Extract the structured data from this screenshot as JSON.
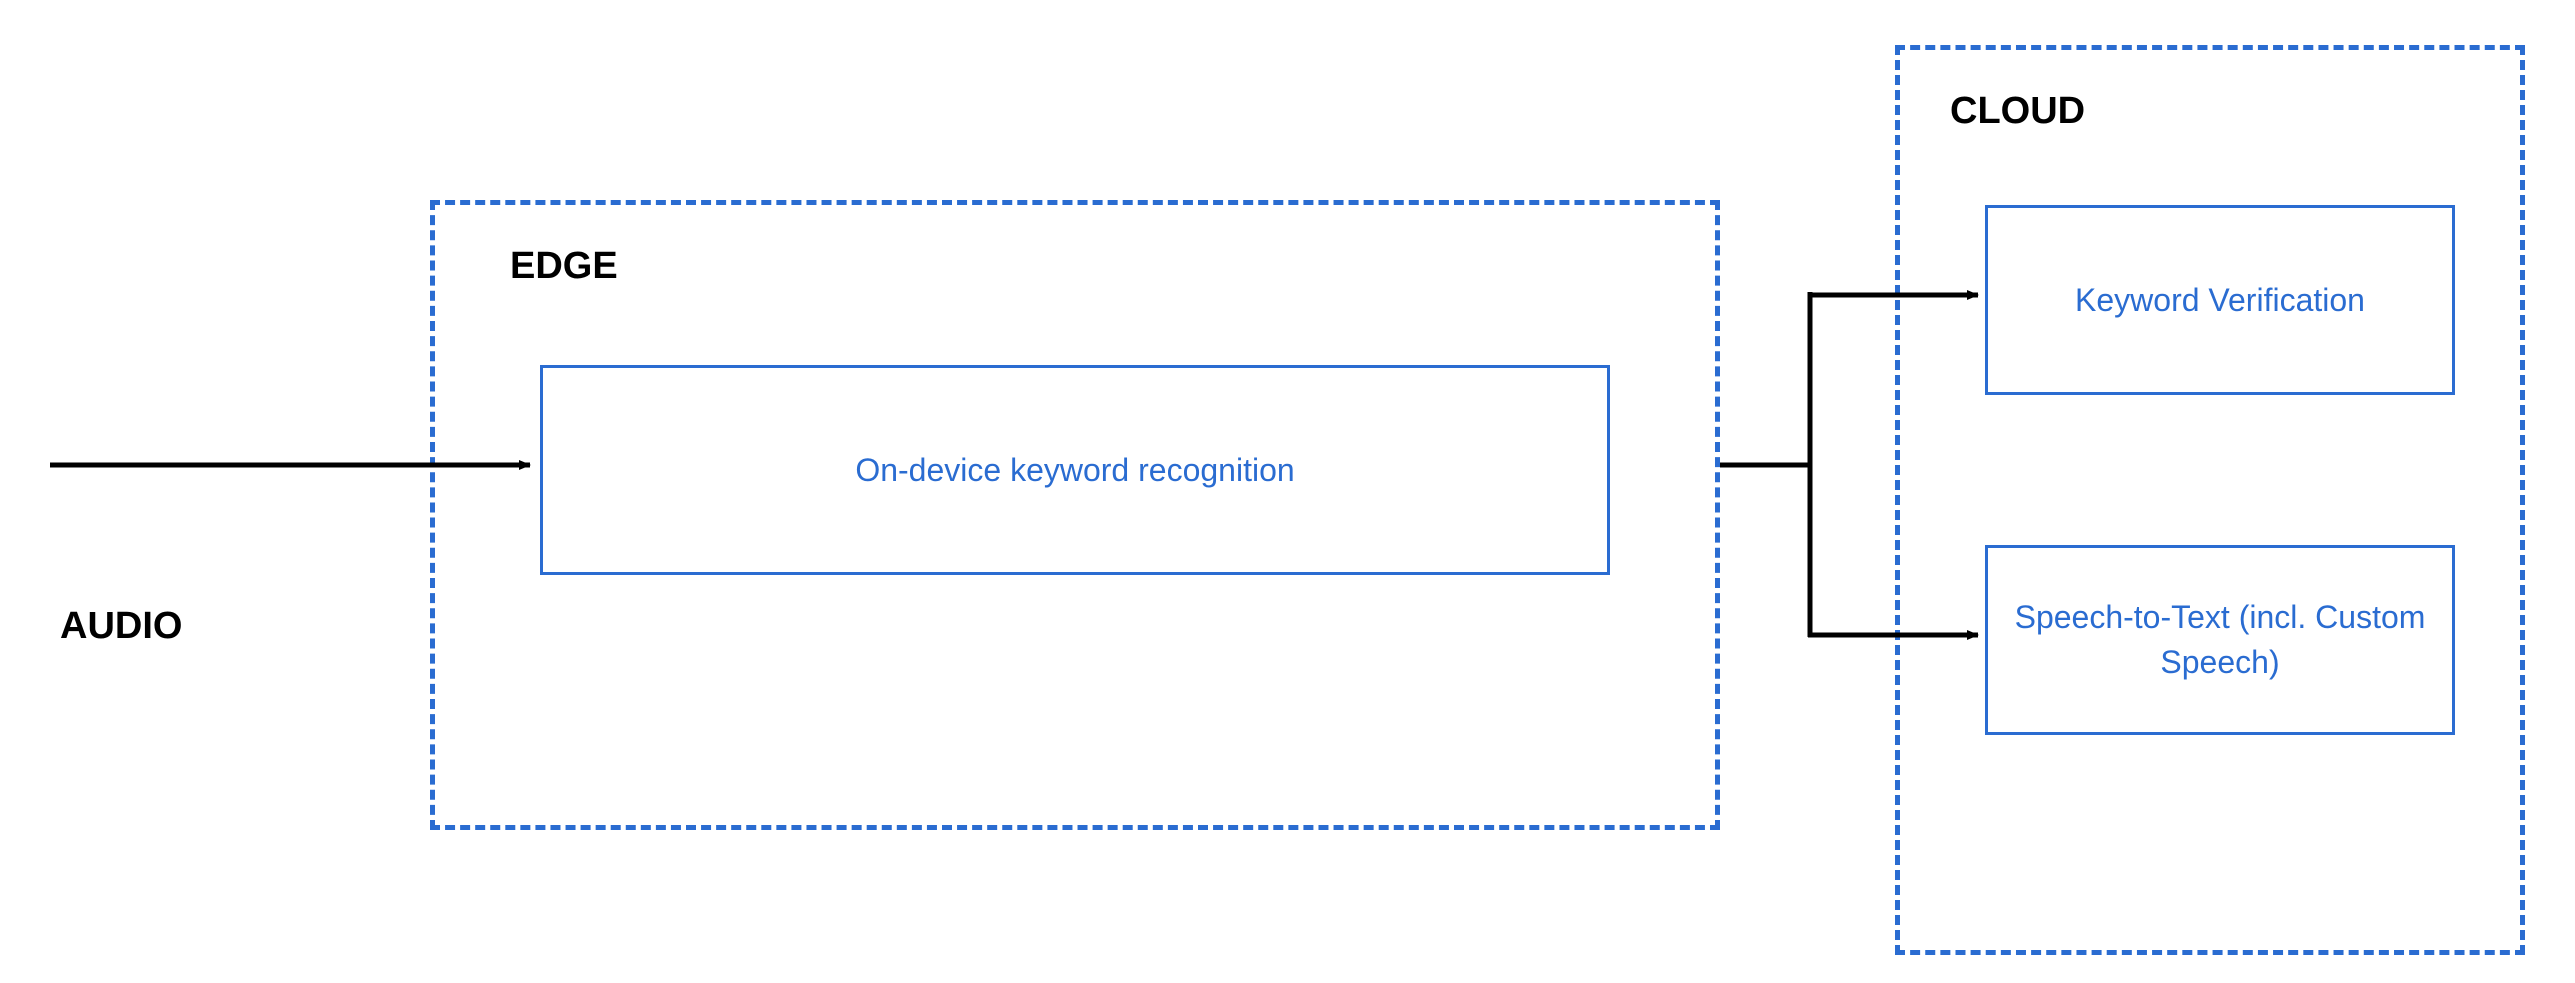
{
  "audio_label": "AUDIO",
  "edge": {
    "label": "EDGE",
    "box_text": "On-device keyword recognition"
  },
  "cloud": {
    "label": "CLOUD",
    "box1_text": "Keyword Verification",
    "box2_text": "Speech-to-Text (incl. Custom Speech)"
  }
}
